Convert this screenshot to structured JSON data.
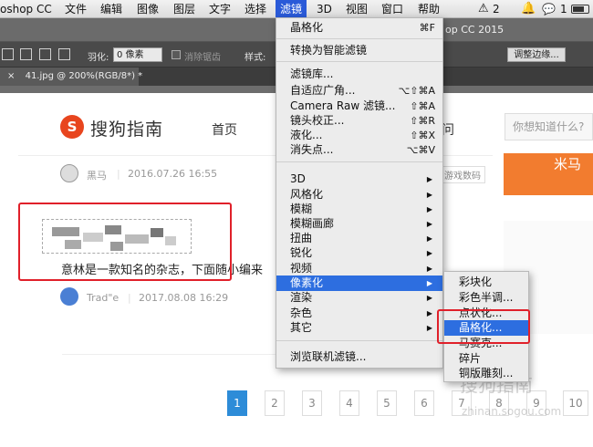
{
  "menubar": {
    "app": "oshop CC",
    "items": [
      "文件",
      "编辑",
      "图像",
      "图层",
      "文字",
      "选择",
      "滤镜",
      "3D",
      "视图",
      "窗口",
      "帮助"
    ],
    "active_index": 6,
    "status_badge": "2",
    "status_badge2": "1"
  },
  "titlestrip": {
    "text": "op CC 2015"
  },
  "optionsbar": {
    "feather_label": "羽化:",
    "feather_value": "0 像素",
    "antialias_label": "消除锯齿",
    "style_label": "样式:",
    "refine_edge_button": "调整边缘..."
  },
  "doctab": {
    "close": "×",
    "title": "41.jpg @ 200%(RGB/8*) *"
  },
  "page": {
    "logo_letter": "S",
    "logo_text": "搜狗指南",
    "nav_home": "首页",
    "nav_question": "问",
    "search_placeholder": "你想知道什么?",
    "author1": "黑马",
    "date1": "2016.07.26 16:55",
    "tag": "游戏数码",
    "orange_text": "米马",
    "description": "意林是一款知名的杂志，下面随小编来",
    "author2": "Trad\"e",
    "date2": "2017.08.08 16:29",
    "pages": [
      "1",
      "2",
      "3",
      "4",
      "5",
      "6",
      "7",
      "8",
      "9",
      "10"
    ],
    "active_page": "1",
    "watermark1": "搜狗指南",
    "watermark2": "zhinan.sogou.com"
  },
  "filter_menu": {
    "top": [
      {
        "label": "晶格化",
        "shortcut": "⌘F"
      }
    ],
    "group1": [
      {
        "label": "转换为智能滤镜"
      }
    ],
    "group2": [
      {
        "label": "滤镜库..."
      },
      {
        "label": "自适应广角...",
        "shortcut": "⌥⇧⌘A"
      },
      {
        "label": "Camera Raw 滤镜...",
        "shortcut": "⇧⌘A"
      },
      {
        "label": "镜头校正...",
        "shortcut": "⇧⌘R"
      },
      {
        "label": "液化...",
        "shortcut": "⇧⌘X"
      },
      {
        "label": "消失点...",
        "shortcut": "⌥⌘V"
      }
    ],
    "group3": [
      {
        "label": "3D"
      },
      {
        "label": "风格化"
      },
      {
        "label": "模糊"
      },
      {
        "label": "模糊画廊"
      },
      {
        "label": "扭曲"
      },
      {
        "label": "锐化"
      },
      {
        "label": "视频"
      },
      {
        "label": "像素化"
      },
      {
        "label": "渲染"
      },
      {
        "label": "杂色"
      },
      {
        "label": "其它"
      }
    ],
    "group4": [
      {
        "label": "浏览联机滤镜..."
      }
    ],
    "highlighted": "像素化"
  },
  "pixelate_submenu": {
    "items": [
      "彩块化",
      "彩色半调...",
      "点状化...",
      "晶格化...",
      "马赛克...",
      "碎片",
      "铜版雕刻..."
    ],
    "highlighted": "晶格化..."
  },
  "colors": {
    "accent": "#2d6ee0",
    "annotation": "#e0202a",
    "sogou": "#e8451e"
  }
}
